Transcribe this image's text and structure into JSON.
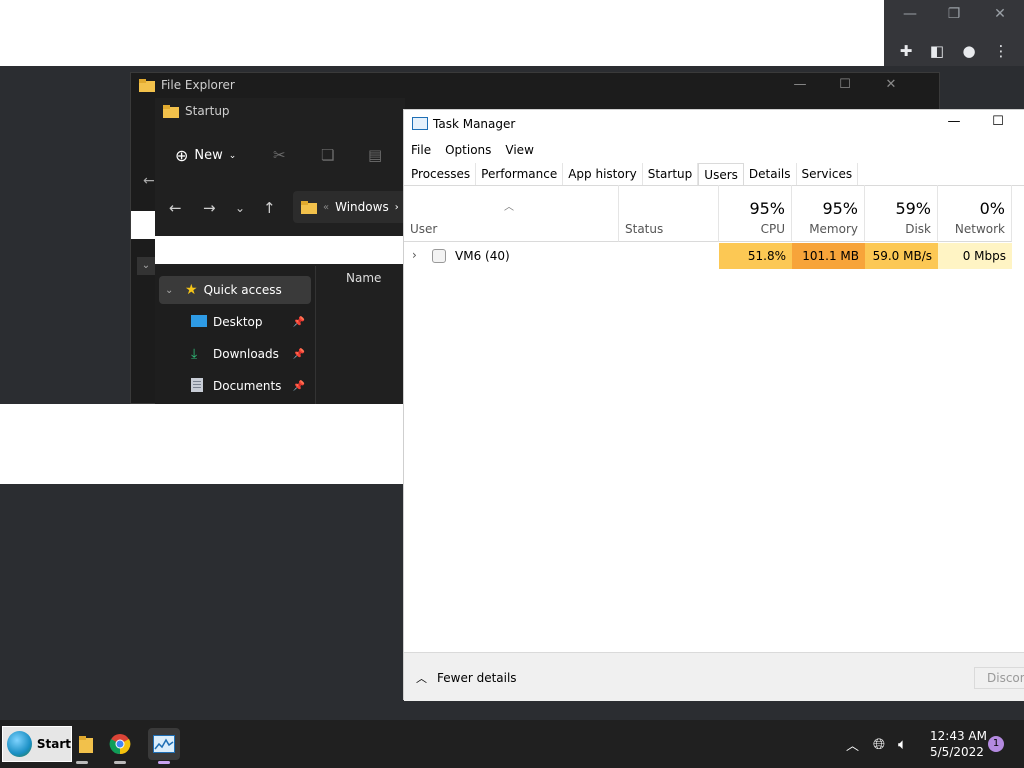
{
  "file_explorer_back": {
    "title": "File Explorer"
  },
  "file_explorer_front": {
    "title": "Startup",
    "new_label": "New",
    "address_label": "Windows",
    "column_name": "Name",
    "nav_items": [
      {
        "label": "Quick access",
        "icon": "star-icon"
      },
      {
        "label": "Desktop",
        "icon": "desktop-icon"
      },
      {
        "label": "Downloads",
        "icon": "download-icon"
      },
      {
        "label": "Documents",
        "icon": "documents-icon"
      }
    ]
  },
  "task_manager": {
    "title": "Task Manager",
    "menu": [
      "File",
      "Options",
      "View"
    ],
    "tabs": [
      "Processes",
      "Performance",
      "App history",
      "Startup",
      "Users",
      "Details",
      "Services"
    ],
    "active_tab": "Users",
    "columns": {
      "user": "User",
      "status": "Status",
      "cpu": {
        "pct": "95%",
        "label": "CPU"
      },
      "memory": {
        "pct": "95%",
        "label": "Memory"
      },
      "disk": {
        "pct": "59%",
        "label": "Disk"
      },
      "network": {
        "pct": "0%",
        "label": "Network"
      }
    },
    "rows": [
      {
        "user": "VM6 (40)",
        "status": "",
        "cpu": "51.8%",
        "memory": "101.1 MB",
        "disk": "59.0 MB/s",
        "network": "0 Mbps"
      }
    ],
    "footer": {
      "fewer_details": "Fewer details",
      "disconnect": "Discon"
    },
    "heat_colors": {
      "cpu": "#fcc854",
      "memory": "#f7a43a",
      "disk": "#fcc854",
      "network": "#fff4c4"
    }
  },
  "taskbar": {
    "start_label": "Start",
    "clock_time": "12:43 AM",
    "clock_date": "5/5/2022",
    "notification_count": "1"
  }
}
